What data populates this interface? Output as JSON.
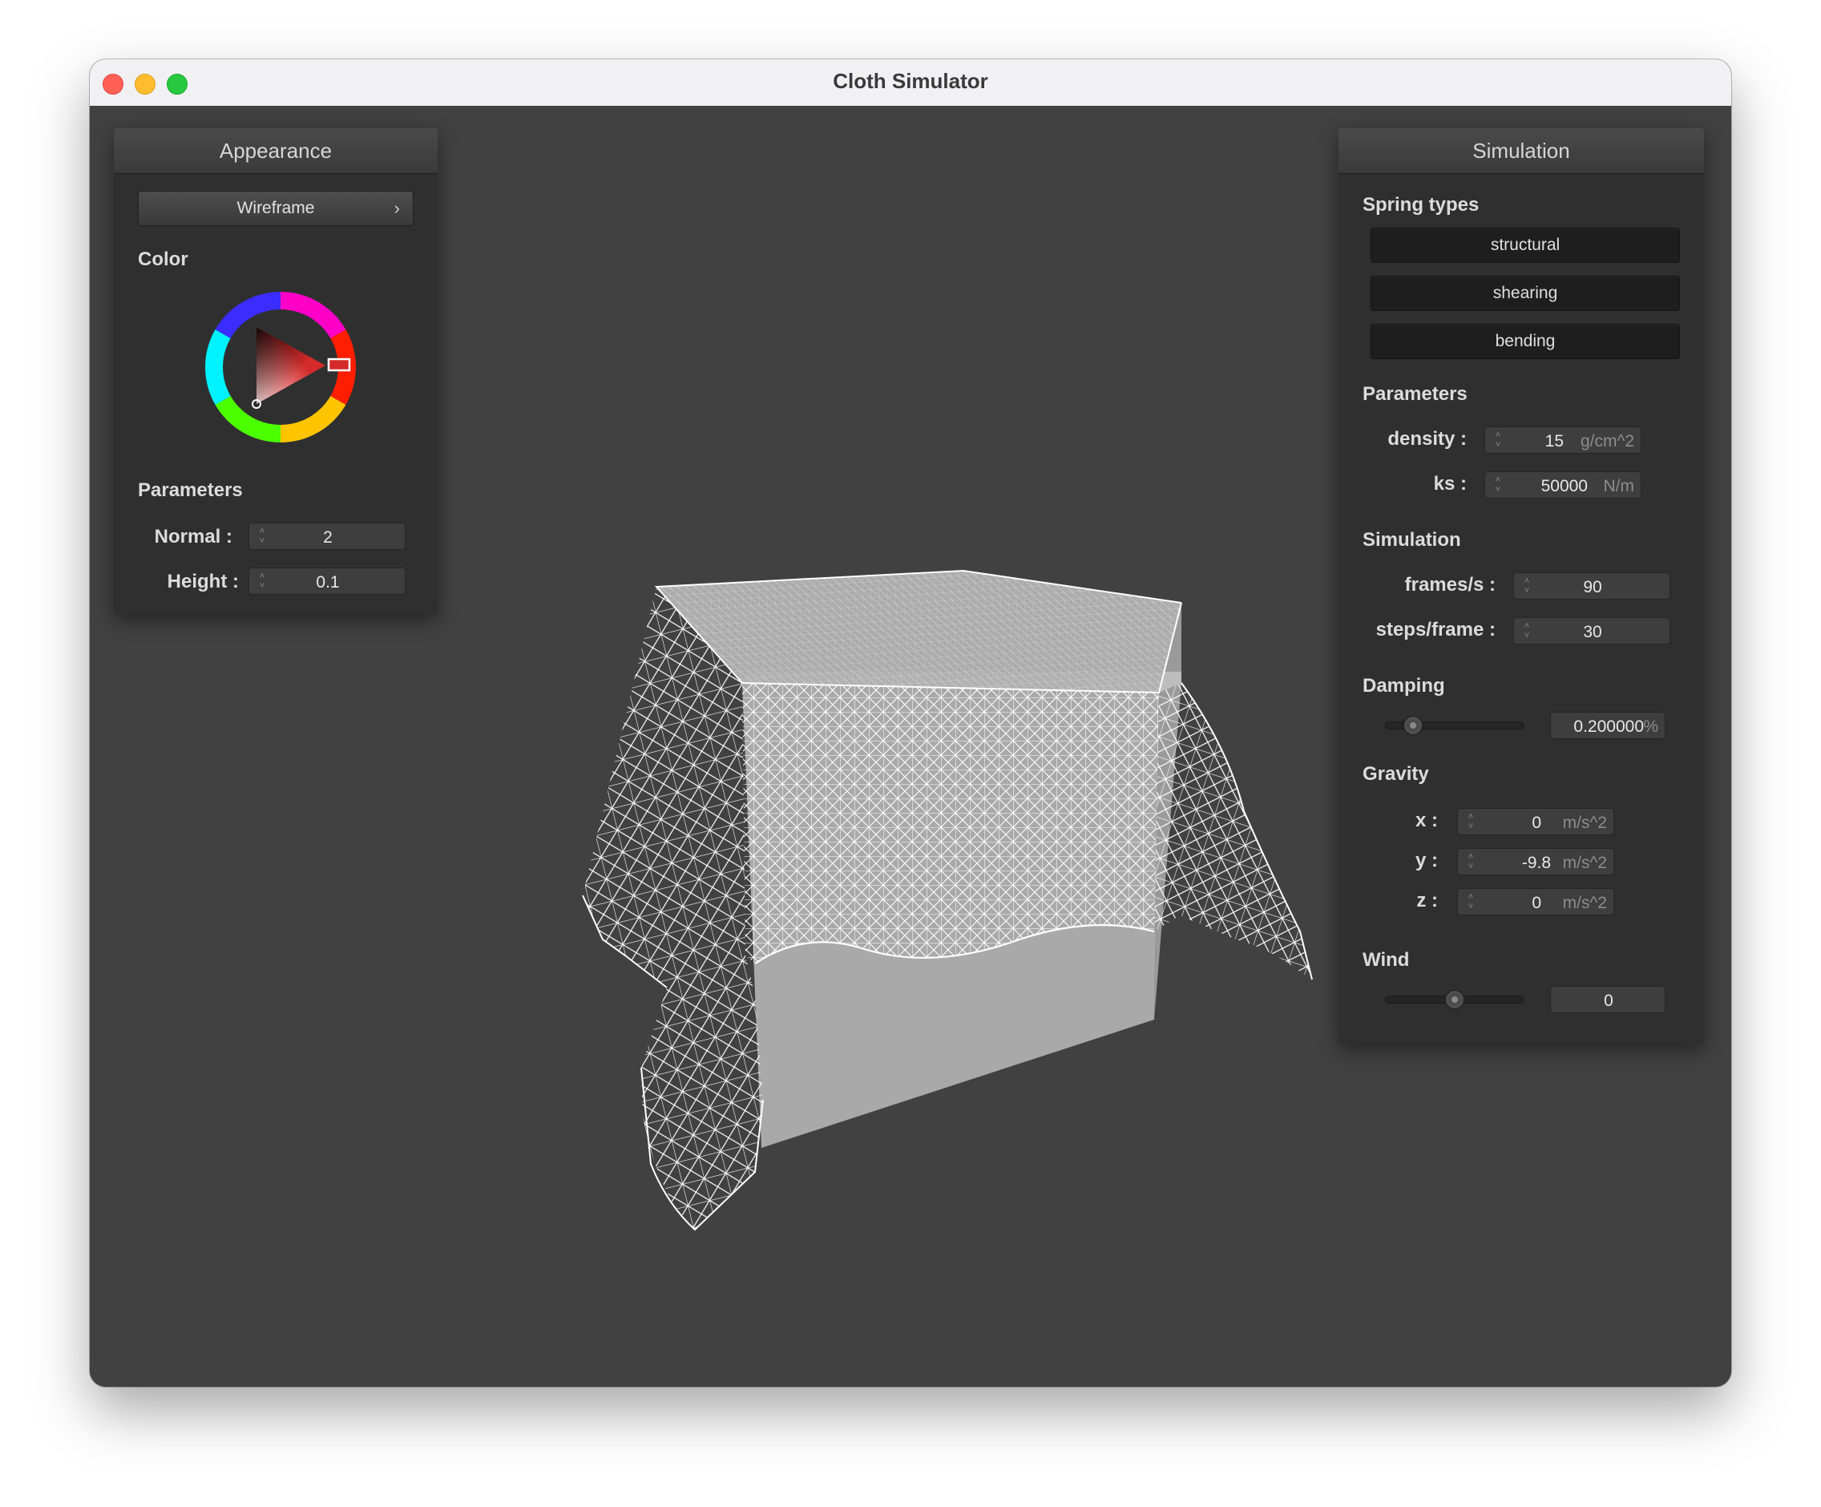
{
  "window": {
    "title": "Cloth Simulator"
  },
  "appearance": {
    "header": "Appearance",
    "shader_selected": "Wireframe",
    "color_label": "Color",
    "color_value": "#d42a2a",
    "parameters_label": "Parameters",
    "normal": {
      "label": "Normal :",
      "value": "2"
    },
    "height": {
      "label": "Height :",
      "value": "0.1"
    }
  },
  "simulation": {
    "header": "Simulation",
    "spring_types_label": "Spring types",
    "spring_types": [
      "structural",
      "shearing",
      "bending"
    ],
    "parameters_label": "Parameters",
    "density": {
      "label": "density :",
      "value": "15",
      "unit": "g/cm^2"
    },
    "ks": {
      "label": "ks :",
      "value": "50000",
      "unit": "N/m"
    },
    "simulation_label": "Simulation",
    "frames_per_s": {
      "label": "frames/s :",
      "value": "90"
    },
    "steps_per_frame": {
      "label": "steps/frame :",
      "value": "30"
    },
    "damping_label": "Damping",
    "damping": {
      "value": "0.200000",
      "unit": "%",
      "slider_fraction": 0.2
    },
    "gravity_label": "Gravity",
    "gravity": {
      "x": {
        "label": "x :",
        "value": "0",
        "unit": "m/s^2"
      },
      "y": {
        "label": "y :",
        "value": "-9.8",
        "unit": "m/s^2"
      },
      "z": {
        "label": "z :",
        "value": "0",
        "unit": "m/s^2"
      }
    },
    "wind_label": "Wind",
    "wind": {
      "value": "0",
      "slider_fraction": 0.5
    }
  }
}
